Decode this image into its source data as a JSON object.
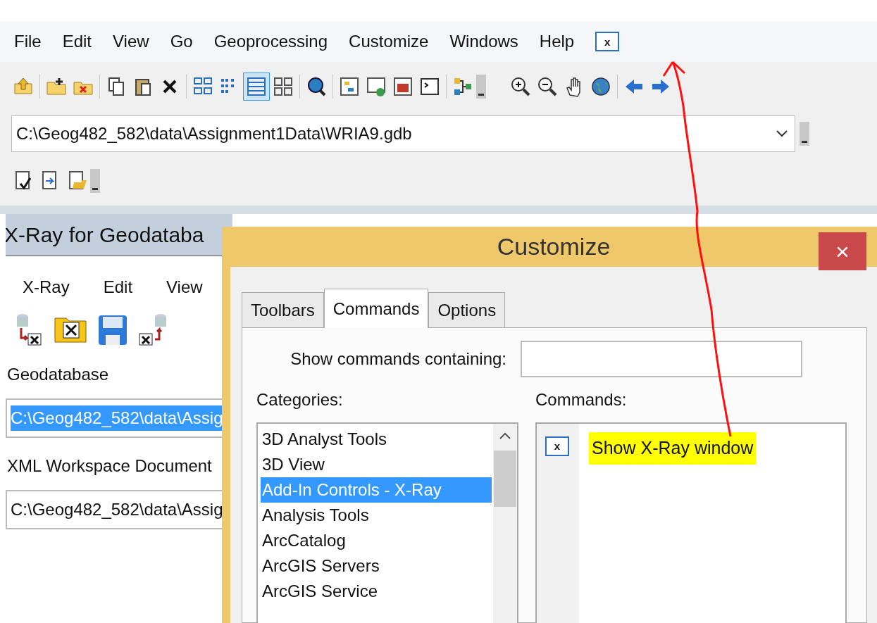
{
  "menu_bar": {
    "items": [
      "File",
      "Edit",
      "View",
      "Go",
      "Geoprocessing",
      "Customize",
      "Windows",
      "Help"
    ],
    "addin_button_label": "x"
  },
  "toolbar": {
    "view_modes": [
      {
        "selected": false
      },
      {
        "selected": false
      },
      {
        "selected": true
      },
      {
        "selected": false
      }
    ]
  },
  "location_combo": {
    "value": "C:\\Geog482_582\\data\\Assignment1Data\\WRIA9.gdb"
  },
  "xray_panel": {
    "title": "X-Ray for Geodataba",
    "menu": [
      "X-Ray",
      "Edit",
      "View"
    ],
    "fields": [
      {
        "label": "Geodatabase",
        "value": "C:\\Geog482_582\\data\\Assig",
        "selected": true
      },
      {
        "label": "XML Workspace Document",
        "value": "C:\\Geog482_582\\data\\Assig",
        "selected": false
      }
    ]
  },
  "dialog": {
    "title": "Customize",
    "close": "×",
    "tabs": [
      {
        "label": "Toolbars",
        "selected": false
      },
      {
        "label": "Commands",
        "selected": true
      },
      {
        "label": "Options",
        "selected": false
      }
    ],
    "search_label": "Show commands containing:",
    "categories_label": "Categories:",
    "categories": [
      {
        "label": "3D Analyst Tools",
        "selected": false
      },
      {
        "label": "3D View",
        "selected": false
      },
      {
        "label": "Add-In Controls - X-Ray",
        "selected": true
      },
      {
        "label": "Analysis Tools",
        "selected": false
      },
      {
        "label": "ArcCatalog",
        "selected": false
      },
      {
        "label": "ArcGIS Servers",
        "selected": false
      },
      {
        "label": "ArcGIS Service",
        "selected": false
      }
    ],
    "commands_label": "Commands:",
    "commands": [
      {
        "icon_label": "x",
        "label": "Show X-Ray window",
        "highlighted": true
      }
    ]
  }
}
